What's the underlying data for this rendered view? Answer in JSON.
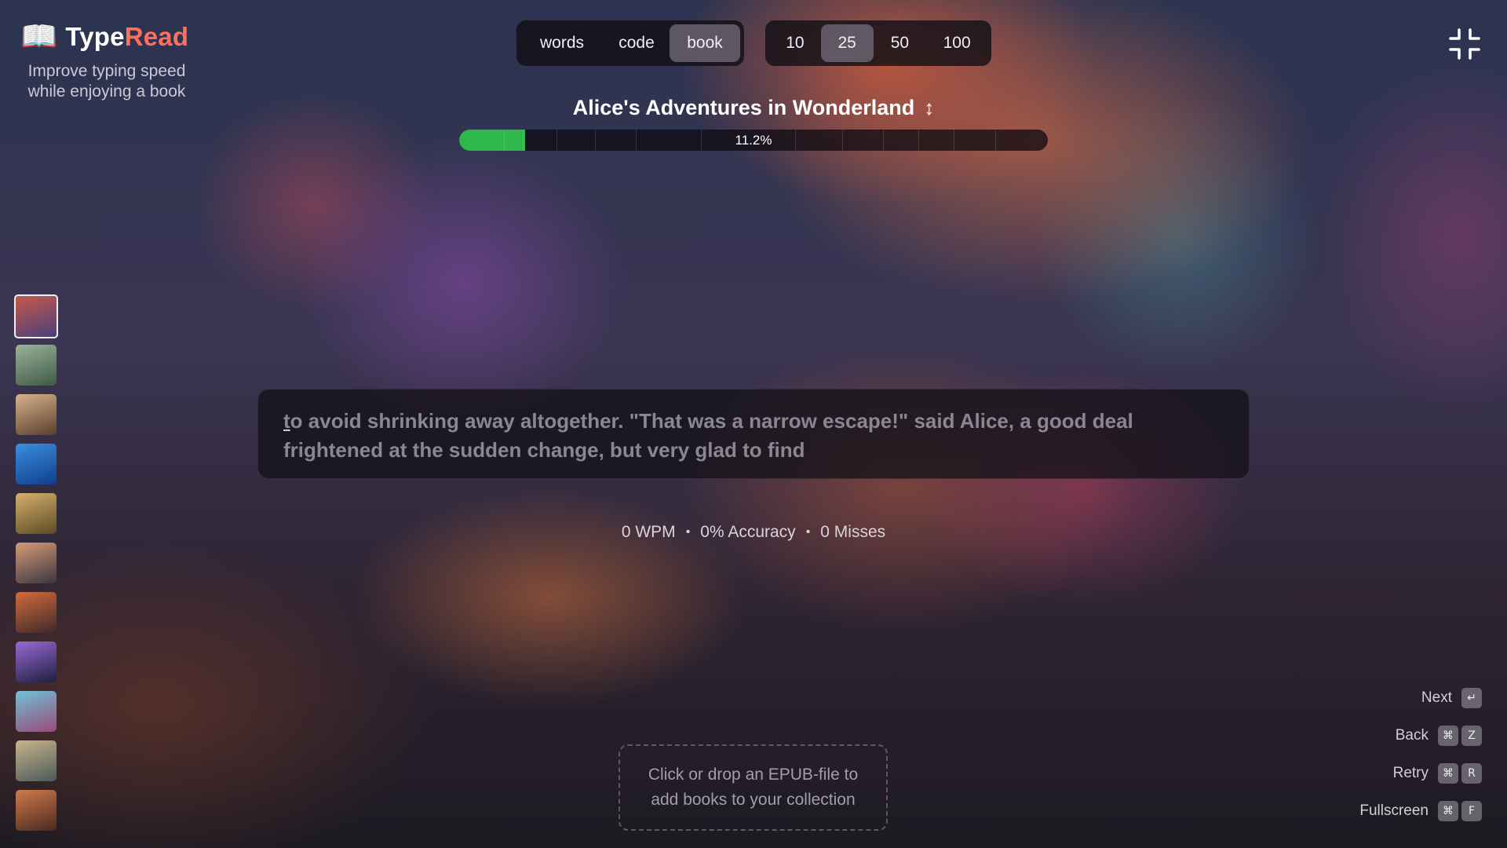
{
  "app": {
    "logo_icon": "open-book-icon",
    "name_part1": "Type",
    "name_part2": "Read",
    "tagline": "Improve typing speed while enjoying a book",
    "colors": {
      "accent": "#ff6f5c",
      "progress": "#2fb84a"
    }
  },
  "modes": {
    "items": [
      {
        "label": "words",
        "active": false
      },
      {
        "label": "code",
        "active": false
      },
      {
        "label": "book",
        "active": true
      }
    ]
  },
  "counts": {
    "items": [
      {
        "label": "10",
        "active": false
      },
      {
        "label": "25",
        "active": true
      },
      {
        "label": "50",
        "active": false
      },
      {
        "label": "100",
        "active": false
      }
    ]
  },
  "exit_fullscreen_icon": "exit-fullscreen-icon",
  "book": {
    "title": "Alice's Adventures in Wonderland",
    "switch_icon": "up-down-arrow-icon",
    "progress_percent": 11.2,
    "progress_label": "11.2%"
  },
  "thumbnails": [
    {
      "name": "theme-fantasy-castle",
      "active": true,
      "colors": [
        "#c65a4a",
        "#4a3f7a"
      ]
    },
    {
      "name": "theme-forest-stream",
      "active": false,
      "colors": [
        "#9bb39a",
        "#3d5a46"
      ]
    },
    {
      "name": "theme-cozy-candles",
      "active": false,
      "colors": [
        "#d7b48c",
        "#5a3e2c"
      ]
    },
    {
      "name": "theme-underwater",
      "active": false,
      "colors": [
        "#3a8fe0",
        "#103e8a"
      ]
    },
    {
      "name": "theme-wheat-field",
      "active": false,
      "colors": [
        "#d6b06a",
        "#5c4a25"
      ]
    },
    {
      "name": "theme-dusk-lake",
      "active": false,
      "colors": [
        "#d69a78",
        "#3a3740"
      ]
    },
    {
      "name": "theme-autumn-valley",
      "active": false,
      "colors": [
        "#d46a3a",
        "#3d2a2a"
      ]
    },
    {
      "name": "theme-neon-city",
      "active": false,
      "colors": [
        "#9a6ad6",
        "#1e1f3e"
      ]
    },
    {
      "name": "theme-crystal-mountain",
      "active": false,
      "colors": [
        "#6fc2d6",
        "#9a4a7a"
      ]
    },
    {
      "name": "theme-canyon-river",
      "active": false,
      "colors": [
        "#c9b48a",
        "#4a5a5a"
      ]
    },
    {
      "name": "theme-autumn-tree",
      "active": false,
      "colors": [
        "#d07a4a",
        "#4a2a20"
      ]
    }
  ],
  "passage": {
    "cursor_char": "t",
    "rest": "o avoid shrinking away altogether. \"That was a narrow escape!\" said Alice, a good deal frightened at the sudden change, but very glad to find"
  },
  "stats": {
    "wpm": "0 WPM",
    "accuracy": "0% Accuracy",
    "misses": "0 Misses"
  },
  "dropzone": {
    "line1": "Click or drop an EPUB-file to",
    "line2": "add books to your collection"
  },
  "shortcuts": [
    {
      "label": "Next",
      "keys": [
        "↵"
      ]
    },
    {
      "label": "Back",
      "keys": [
        "⌘",
        "Z"
      ]
    },
    {
      "label": "Retry",
      "keys": [
        "⌘",
        "R"
      ]
    },
    {
      "label": "Fullscreen",
      "keys": [
        "⌘",
        "F"
      ]
    }
  ]
}
